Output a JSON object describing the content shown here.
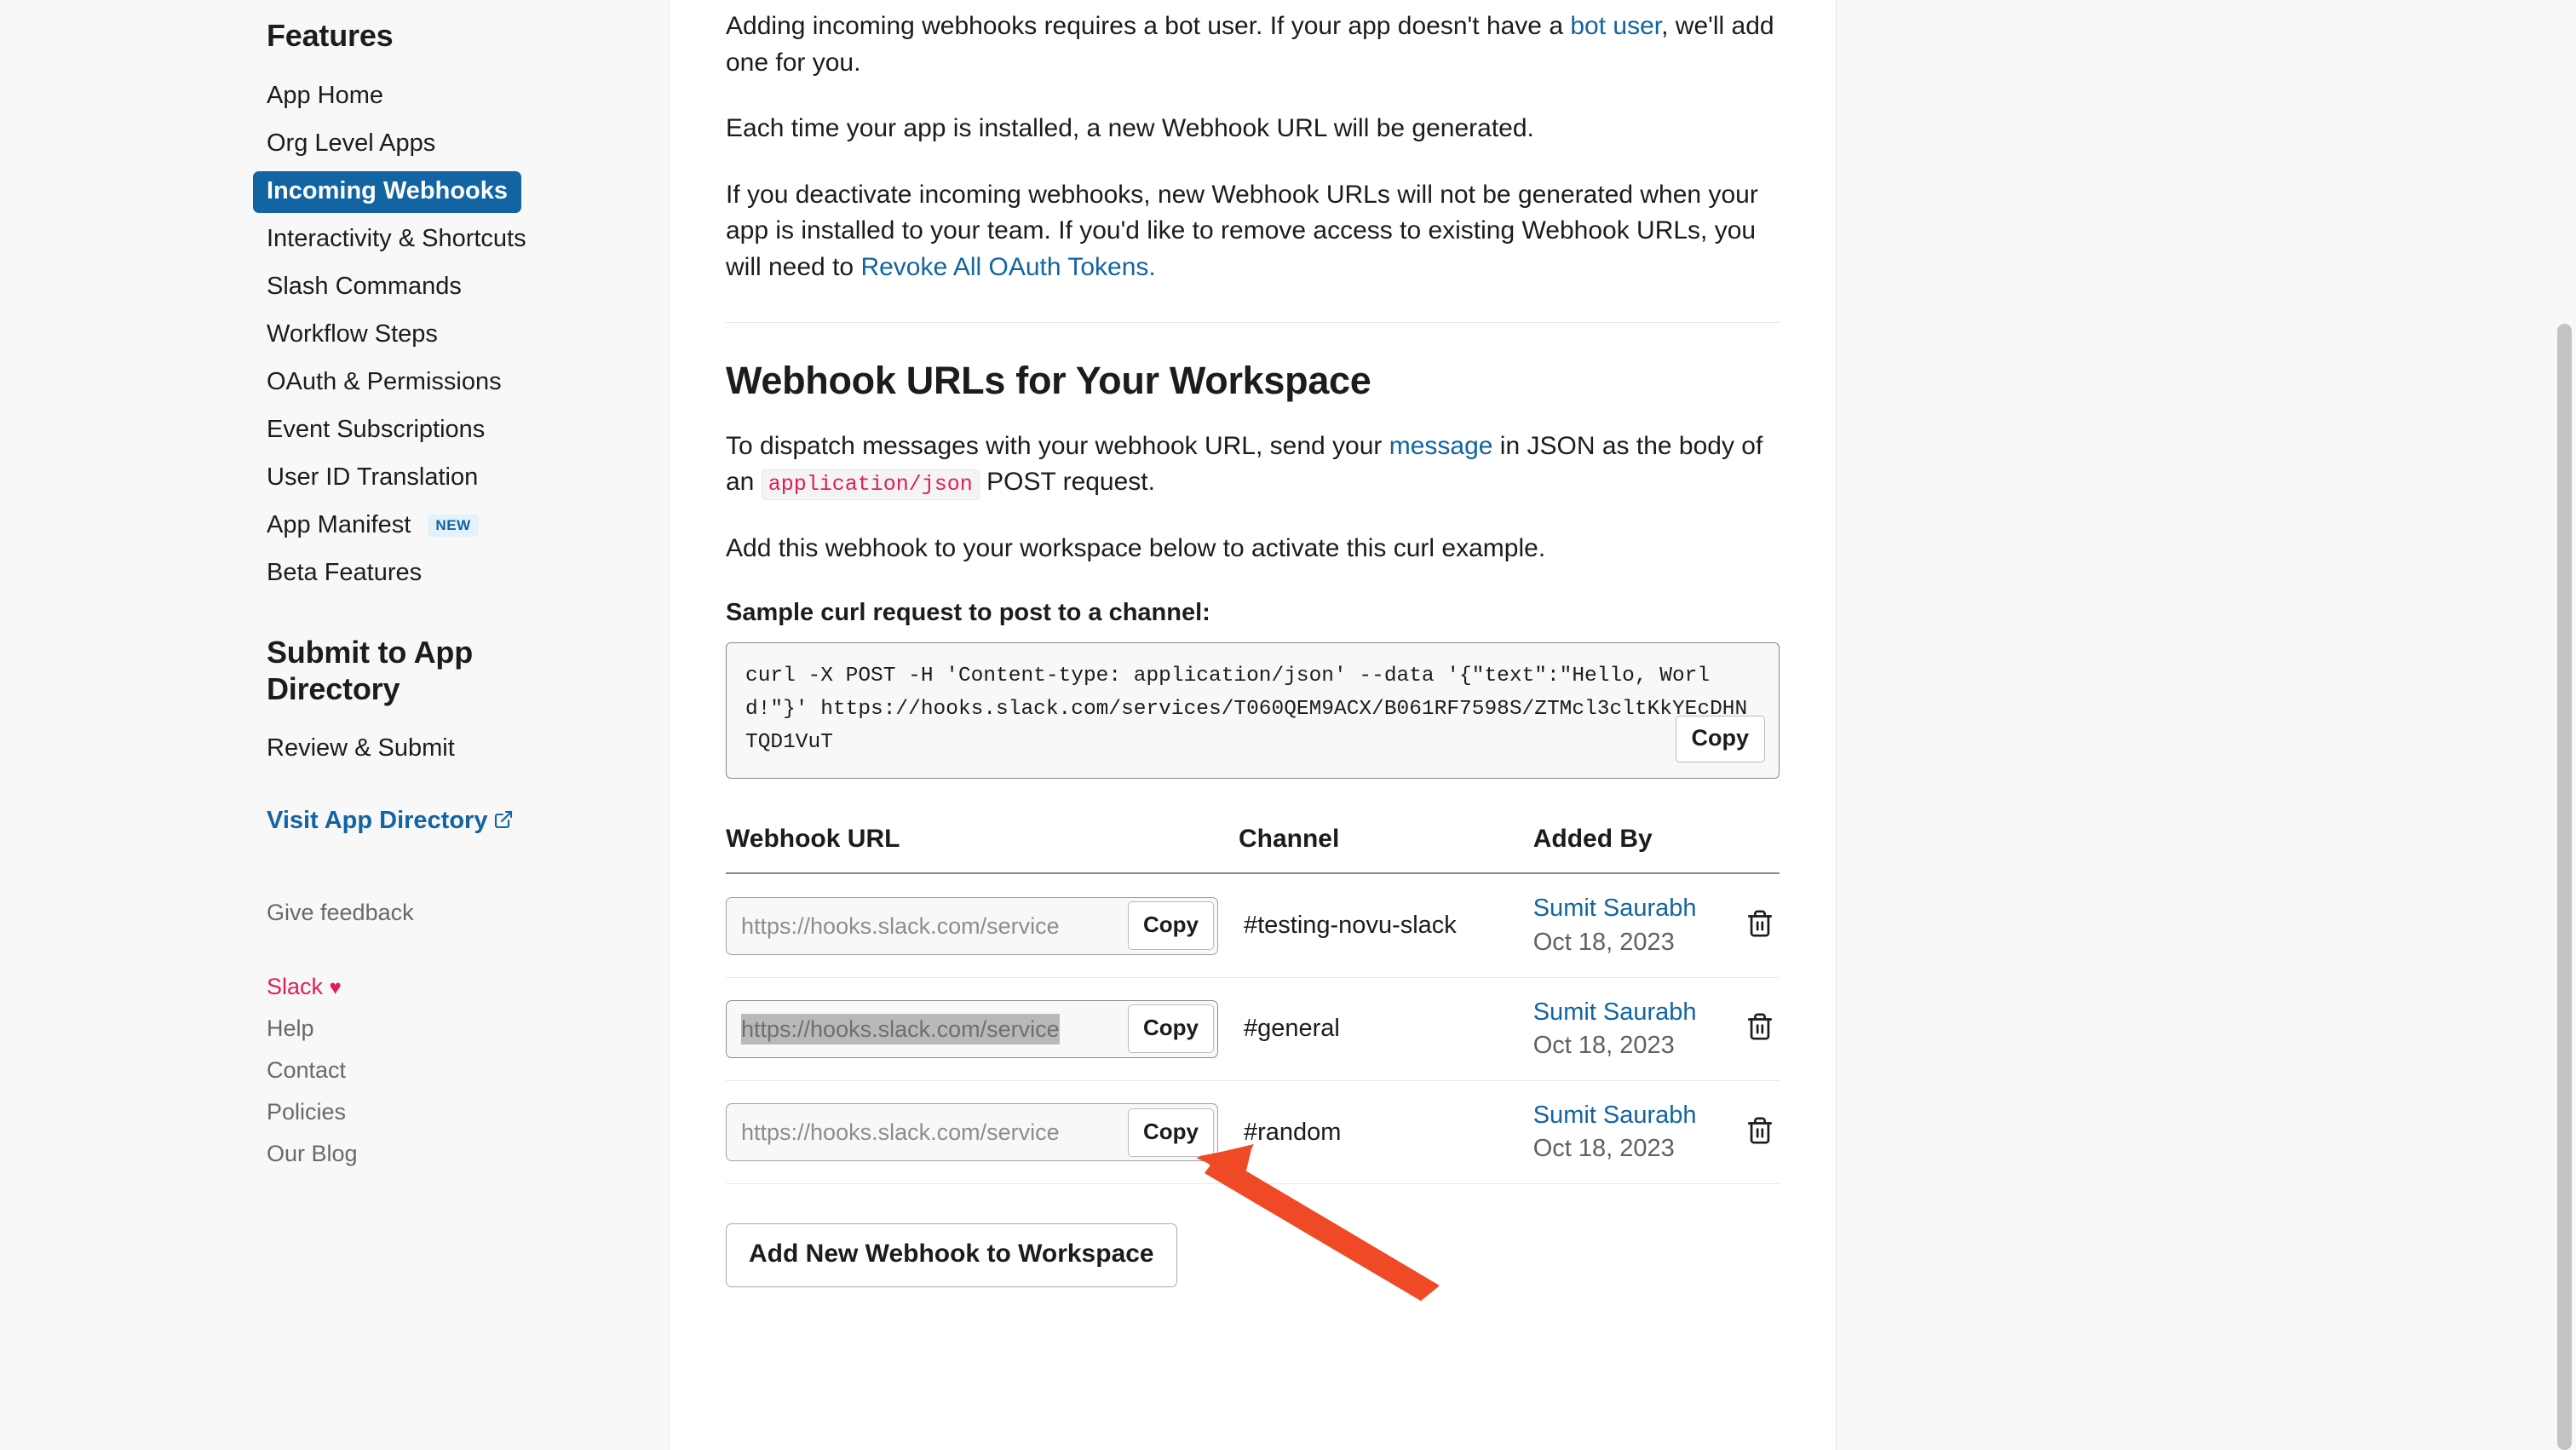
{
  "sidebar": {
    "features_heading": "Features",
    "nav_items": [
      {
        "label": "App Home",
        "active": false,
        "badge": ""
      },
      {
        "label": "Org Level Apps",
        "active": false,
        "badge": ""
      },
      {
        "label": "Incoming Webhooks",
        "active": true,
        "badge": ""
      },
      {
        "label": "Interactivity & Shortcuts",
        "active": false,
        "badge": ""
      },
      {
        "label": "Slash Commands",
        "active": false,
        "badge": ""
      },
      {
        "label": "Workflow Steps",
        "active": false,
        "badge": ""
      },
      {
        "label": "OAuth & Permissions",
        "active": false,
        "badge": ""
      },
      {
        "label": "Event Subscriptions",
        "active": false,
        "badge": ""
      },
      {
        "label": "User ID Translation",
        "active": false,
        "badge": ""
      },
      {
        "label": "App Manifest",
        "active": false,
        "badge": "NEW"
      },
      {
        "label": "Beta Features",
        "active": false,
        "badge": ""
      }
    ],
    "submit_heading": "Submit to App Directory",
    "submit_items": [
      {
        "label": "Review & Submit"
      }
    ],
    "visit_app_directory": "Visit App Directory",
    "visit_app_directory_icon": "external-link-icon",
    "give_feedback": "Give feedback",
    "footer_links": [
      {
        "label": "Slack",
        "heart": "♥",
        "accent": true
      },
      {
        "label": "Help",
        "heart": "",
        "accent": false
      },
      {
        "label": "Contact",
        "heart": "",
        "accent": false
      },
      {
        "label": "Policies",
        "heart": "",
        "accent": false
      },
      {
        "label": "Our Blog",
        "heart": "",
        "accent": false
      }
    ]
  },
  "main": {
    "intro": {
      "p1_a": "Adding incoming webhooks requires a bot user. If your app doesn't have a ",
      "p1_link": "bot user",
      "p1_b": ", we'll add one for you.",
      "p2": "Each time your app is installed, a new Webhook URL will be generated.",
      "p3_a": "If you deactivate incoming webhooks, new Webhook URLs will not be generated when your app is installed to your team. If you'd like to remove access to existing Webhook URLs, you will need to ",
      "p3_link": "Revoke All OAuth Tokens."
    },
    "section": {
      "heading": "Webhook URLs for Your Workspace",
      "p1_a": "To dispatch messages with your webhook URL, send your ",
      "p1_link": "message",
      "p1_b": " in JSON as the body of an ",
      "p1_code": "application/json",
      "p1_c": " POST request.",
      "p2": "Add this webhook to your workspace below to activate this curl example."
    },
    "curl": {
      "label": "Sample curl request to post to a channel:",
      "command": "curl -X POST -H 'Content-type: application/json' --data '{\"text\":\"Hello, World!\"}' https://hooks.slack.com/services/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",
      "copy_label": "Copy"
    },
    "table": {
      "headers": {
        "url": "Webhook URL",
        "channel": "Channel",
        "added_by": "Added By",
        "delete": ""
      },
      "rows": [
        {
          "url_display": "https://hooks.slack.com/service",
          "url_selected": false,
          "copy_label": "Copy",
          "channel": "#testing-novu-slack",
          "added_by_name": "Sumit Saurabh",
          "added_by_date": "Oct 18, 2023",
          "delete_icon": "trash-icon"
        },
        {
          "url_display": "https://hooks.slack.com/service",
          "url_selected": true,
          "copy_label": "Copy",
          "channel": "#general",
          "added_by_name": "Sumit Saurabh",
          "added_by_date": "Oct 18, 2023",
          "delete_icon": "trash-icon"
        },
        {
          "url_display": "https://hooks.slack.com/service",
          "url_selected": false,
          "copy_label": "Copy",
          "channel": "#random",
          "added_by_name": "Sumit Saurabh",
          "added_by_date": "Oct 18, 2023",
          "delete_icon": "trash-icon"
        }
      ]
    },
    "add_webhook_button": "Add New Webhook to Workspace"
  },
  "annotation": {
    "type": "arrow",
    "color": "#ef4a25",
    "points_to": "copy-button-row-2"
  },
  "colors": {
    "accent_blue": "#1264a3",
    "accent_pink": "#e01e5a",
    "annotation_orange": "#ef4a25",
    "text": "#1d1c1d",
    "muted": "#696969",
    "panel_bg": "#f8f8f8"
  }
}
